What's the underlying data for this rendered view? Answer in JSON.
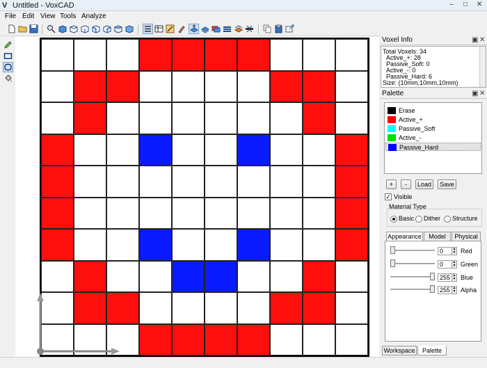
{
  "window": {
    "title": "Untitled - VoxCAD",
    "app_icon": "voxcad-logo-icon"
  },
  "menu": [
    "File",
    "Edit",
    "View",
    "Tools",
    "Analyze"
  ],
  "toolbar": {
    "groups": [
      [
        "new-file-icon",
        "open-folder-icon",
        "save-icon"
      ],
      [
        "zoom-icon",
        "view-cube-icon",
        "view-front-icon",
        "view-back-icon",
        "view-left-icon",
        "view-right-icon",
        "view-top-icon"
      ],
      [
        "list-icon",
        "table-icon",
        "grid-edit-icon",
        "brush-icon",
        "layer-up-icon",
        "layer-view-icon",
        "layer-3d-icon",
        "layer-stack-icon",
        "section-icon",
        "slice-icon"
      ],
      [
        "copy-icon",
        "paste-icon",
        "export-icon"
      ]
    ],
    "selected": [
      "list-icon",
      "layer-up-icon"
    ]
  },
  "left_tools": [
    {
      "icon": "pencil-icon",
      "selected": false
    },
    {
      "icon": "rectangle-icon",
      "selected": false
    },
    {
      "icon": "ellipse-icon",
      "selected": true
    },
    {
      "icon": "bucket-fill-icon",
      "selected": false
    }
  ],
  "grid": {
    "rows": [
      "WWWRRRRWWW",
      "WRRWWWWRRW",
      "WRWWWWWWRW",
      "RWWBWWBWWR",
      "RWWWWWWWWR",
      "RWWWWWWWWR",
      "RWWBWWBWWR",
      "WRWWBBWWRW",
      "WRRWWWWRRW",
      "WWWRRRRWWW"
    ],
    "colors": {
      "W": "#ffffff",
      "R": "#ff0e0e",
      "B": "#0a1aff"
    }
  },
  "voxel_info": {
    "title": "Voxel Info",
    "lines": [
      "Total Voxels: 34",
      "Active_+: 28",
      "Passive_Soft: 0",
      "Active_-: 0",
      "Passive_Hard: 6",
      "Size: (10mm,10mm,10mm)"
    ]
  },
  "palette": {
    "title": "Palette",
    "items": [
      {
        "label": "Erase",
        "color": "#000000"
      },
      {
        "label": "Active_+",
        "color": "#ff0000"
      },
      {
        "label": "Passive_Soft",
        "color": "#00ffff"
      },
      {
        "label": "Active_-",
        "color": "#00e000"
      },
      {
        "label": "Passive_Hard",
        "color": "#0000ff"
      }
    ],
    "selected_index": 4,
    "buttons": {
      "add": "+",
      "remove": "-",
      "load": "Load",
      "save": "Save"
    },
    "visible_label": "Visible",
    "visible_checked": true,
    "material_type": {
      "label": "Material Type",
      "options": [
        "Basic",
        "Dither",
        "Structure"
      ],
      "selected": "Basic"
    },
    "tabs": [
      "Appearance",
      "Model",
      "Physical"
    ],
    "active_tab": "Appearance",
    "channels": [
      {
        "label": "Red",
        "value": "0",
        "level": 0
      },
      {
        "label": "Green",
        "value": "0",
        "level": 0
      },
      {
        "label": "Blue",
        "value": "255",
        "level": 1
      },
      {
        "label": "Alpha",
        "value": "255",
        "level": 1
      }
    ]
  },
  "bottom_tabs": [
    "Workspace",
    "Palette"
  ],
  "bottom_active": "Palette"
}
